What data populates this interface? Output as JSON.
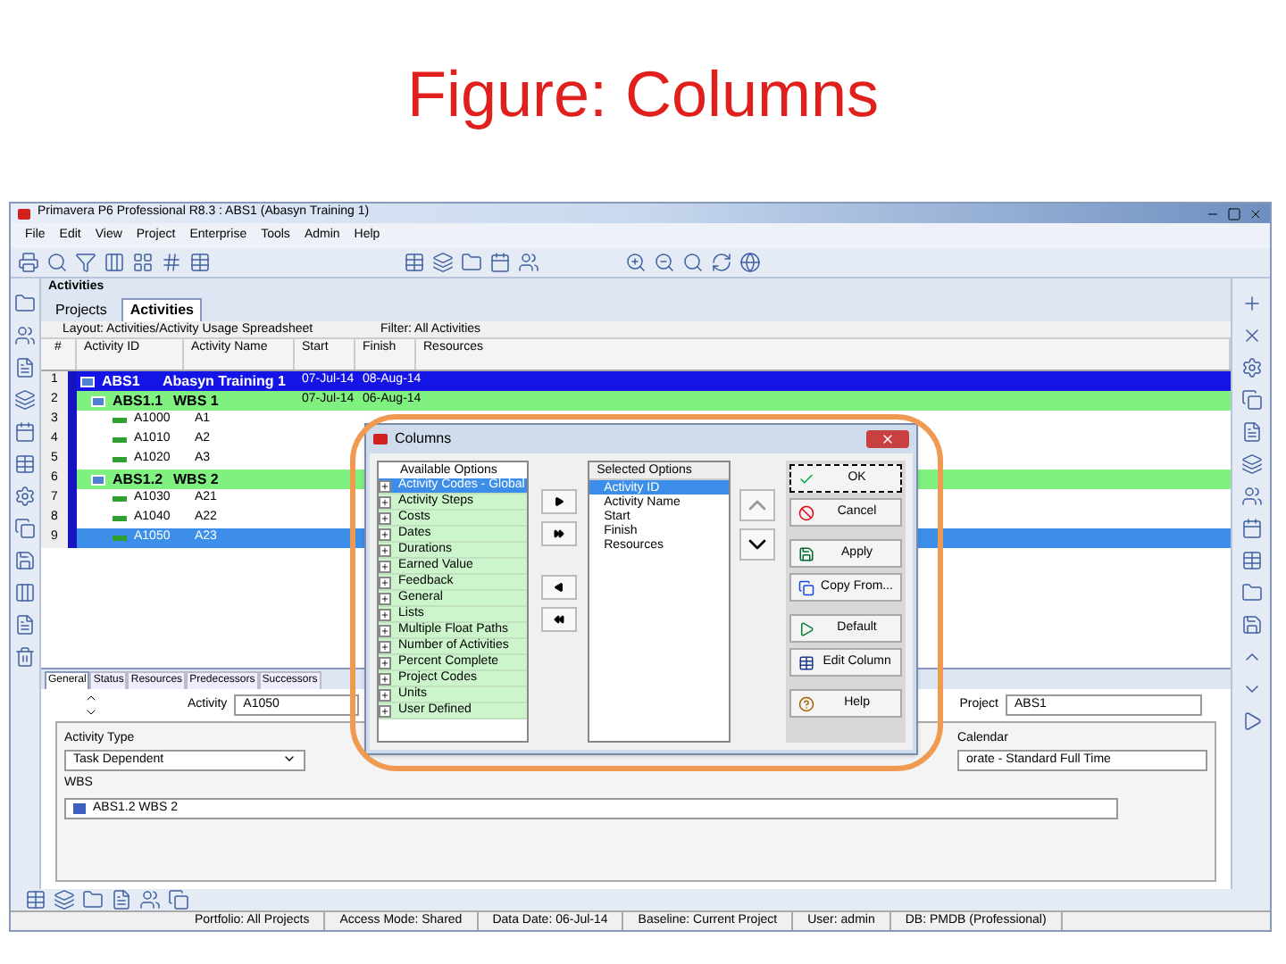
{
  "slide_title": "Figure: Columns",
  "window": {
    "title": "Primavera P6 Professional R8.3 : ABS1 (Abasyn Training 1)"
  },
  "menu": [
    "File",
    "Edit",
    "View",
    "Project",
    "Enterprise",
    "Tools",
    "Admin",
    "Help"
  ],
  "section_title": "Activities",
  "tabs": [
    {
      "label": "Projects",
      "selected": false
    },
    {
      "label": "Activities",
      "selected": true
    }
  ],
  "grid": {
    "layout": "Layout: Activities/Activity Usage Spreadsheet",
    "filter": "Filter: All Activities",
    "columns": [
      "#",
      "Activity ID",
      "Activity Name",
      "Start",
      "Finish",
      "Resources"
    ],
    "rows": [
      {
        "kind": "project",
        "num": "1",
        "id": "ABS1",
        "name": "Abasyn Training 1",
        "start": "07-Jul-14",
        "finish": "08-Aug-14",
        "selected": false
      },
      {
        "kind": "wbs",
        "num": "2",
        "id": "ABS1.1",
        "name": "WBS 1",
        "start": "07-Jul-14",
        "finish": "06-Aug-14",
        "selected": false
      },
      {
        "kind": "activity",
        "num": "3",
        "id": "A1000",
        "name": "A1",
        "selected": false
      },
      {
        "kind": "activity",
        "num": "4",
        "id": "A1010",
        "name": "A2",
        "selected": false
      },
      {
        "kind": "activity",
        "num": "5",
        "id": "A1020",
        "name": "A3",
        "selected": false
      },
      {
        "kind": "wbs",
        "num": "6",
        "id": "ABS1.2",
        "name": "WBS 2",
        "selected": false
      },
      {
        "kind": "activity",
        "num": "7",
        "id": "A1030",
        "name": "A21",
        "selected": false
      },
      {
        "kind": "activity",
        "num": "8",
        "id": "A1040",
        "name": "A22",
        "selected": false
      },
      {
        "kind": "activity",
        "num": "9",
        "id": "A1050",
        "name": "A23",
        "selected": true
      }
    ]
  },
  "details": {
    "tabs": [
      {
        "label": "General",
        "selected": true
      },
      {
        "label": "Status",
        "selected": false
      },
      {
        "label": "Resources",
        "selected": false
      },
      {
        "label": "Predecessors",
        "selected": false
      },
      {
        "label": "Successors",
        "selected": false
      }
    ],
    "activity_label": "Activity",
    "activity_value": "A1050",
    "project_label": "Project",
    "project_value": "ABS1",
    "activity_type_label": "Activity Type",
    "activity_type_value": "Task Dependent",
    "calendar_label": "Calendar",
    "calendar_value": "orate - Standard Full Time",
    "wbs_label": "WBS",
    "wbs_value": "ABS1.2 WBS 2"
  },
  "dialog": {
    "title": "Columns",
    "available_header": "Available Options",
    "available": [
      {
        "label": "Activity Codes - Global",
        "selected": true
      },
      {
        "label": "Activity Steps",
        "selected": false
      },
      {
        "label": "Costs",
        "selected": false
      },
      {
        "label": "Dates",
        "selected": false
      },
      {
        "label": "Durations",
        "selected": false
      },
      {
        "label": "Earned Value",
        "selected": false
      },
      {
        "label": "Feedback",
        "selected": false
      },
      {
        "label": "General",
        "selected": false
      },
      {
        "label": "Lists",
        "selected": false
      },
      {
        "label": "Multiple Float Paths",
        "selected": false
      },
      {
        "label": "Number of Activities",
        "selected": false
      },
      {
        "label": "Percent Complete",
        "selected": false
      },
      {
        "label": "Project Codes",
        "selected": false
      },
      {
        "label": "Units",
        "selected": false
      },
      {
        "label": "User Defined",
        "selected": false
      }
    ],
    "selected_header": "Selected Options",
    "selected_options": [
      {
        "label": "Activity ID",
        "selected": true
      },
      {
        "label": "Activity Name",
        "selected": false
      },
      {
        "label": "Start",
        "selected": false
      },
      {
        "label": "Finish",
        "selected": false
      },
      {
        "label": "Resources",
        "selected": false
      }
    ],
    "buttons": [
      {
        "kind": "ok",
        "label": "OK"
      },
      {
        "kind": "cancel",
        "label": "Cancel"
      },
      {
        "kind": "apply",
        "label": "Apply"
      },
      {
        "kind": "copy",
        "label": "Copy From..."
      },
      {
        "kind": "default",
        "label": "Default"
      },
      {
        "kind": "edit",
        "label": "Edit Column"
      },
      {
        "kind": "help",
        "label": "Help"
      }
    ]
  },
  "status_bar": [
    "Portfolio: All Projects",
    "Access Mode: Shared",
    "Data Date: 06-Jul-14",
    "Baseline: Current Project",
    "User: admin",
    "DB: PMDB (Professional)"
  ]
}
